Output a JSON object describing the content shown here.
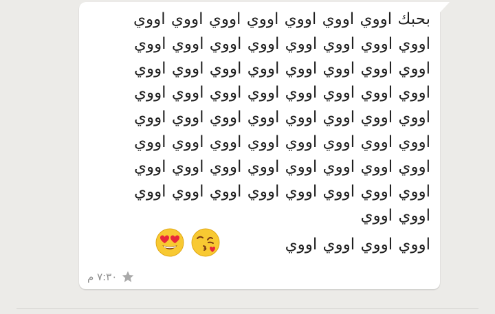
{
  "message": {
    "body": "بحبك اووي اووي اووي اووي اووي اووي اووي اووي اووي اووي اووي اووي اووي اووي اووي اووي اووي اووي اووي اووي اووي اووي اووي اووي اووي اووي اووي اووي اووي اووي اووي اووي اووي اووي اووي اووي اووي اووي اووي اووي اووي اووي اووي اووي اووي اووي اووي اووي اووي اووي اووي اووي اووي اووي اووي اووي اووي اووي اووي اووي اووي اووي اووي اووي اووي",
    "last_line": "اووي اووي اووي اووي",
    "emojis": [
      "smiling-face-with-heart-eyes",
      "face-blowing-a-kiss"
    ],
    "time": "٧:٣٠ م",
    "starred": true
  },
  "colors": {
    "background": "#ecebe8",
    "bubble": "#ffffff",
    "text": "#1f1f1f",
    "meta": "#8c8c8c"
  }
}
